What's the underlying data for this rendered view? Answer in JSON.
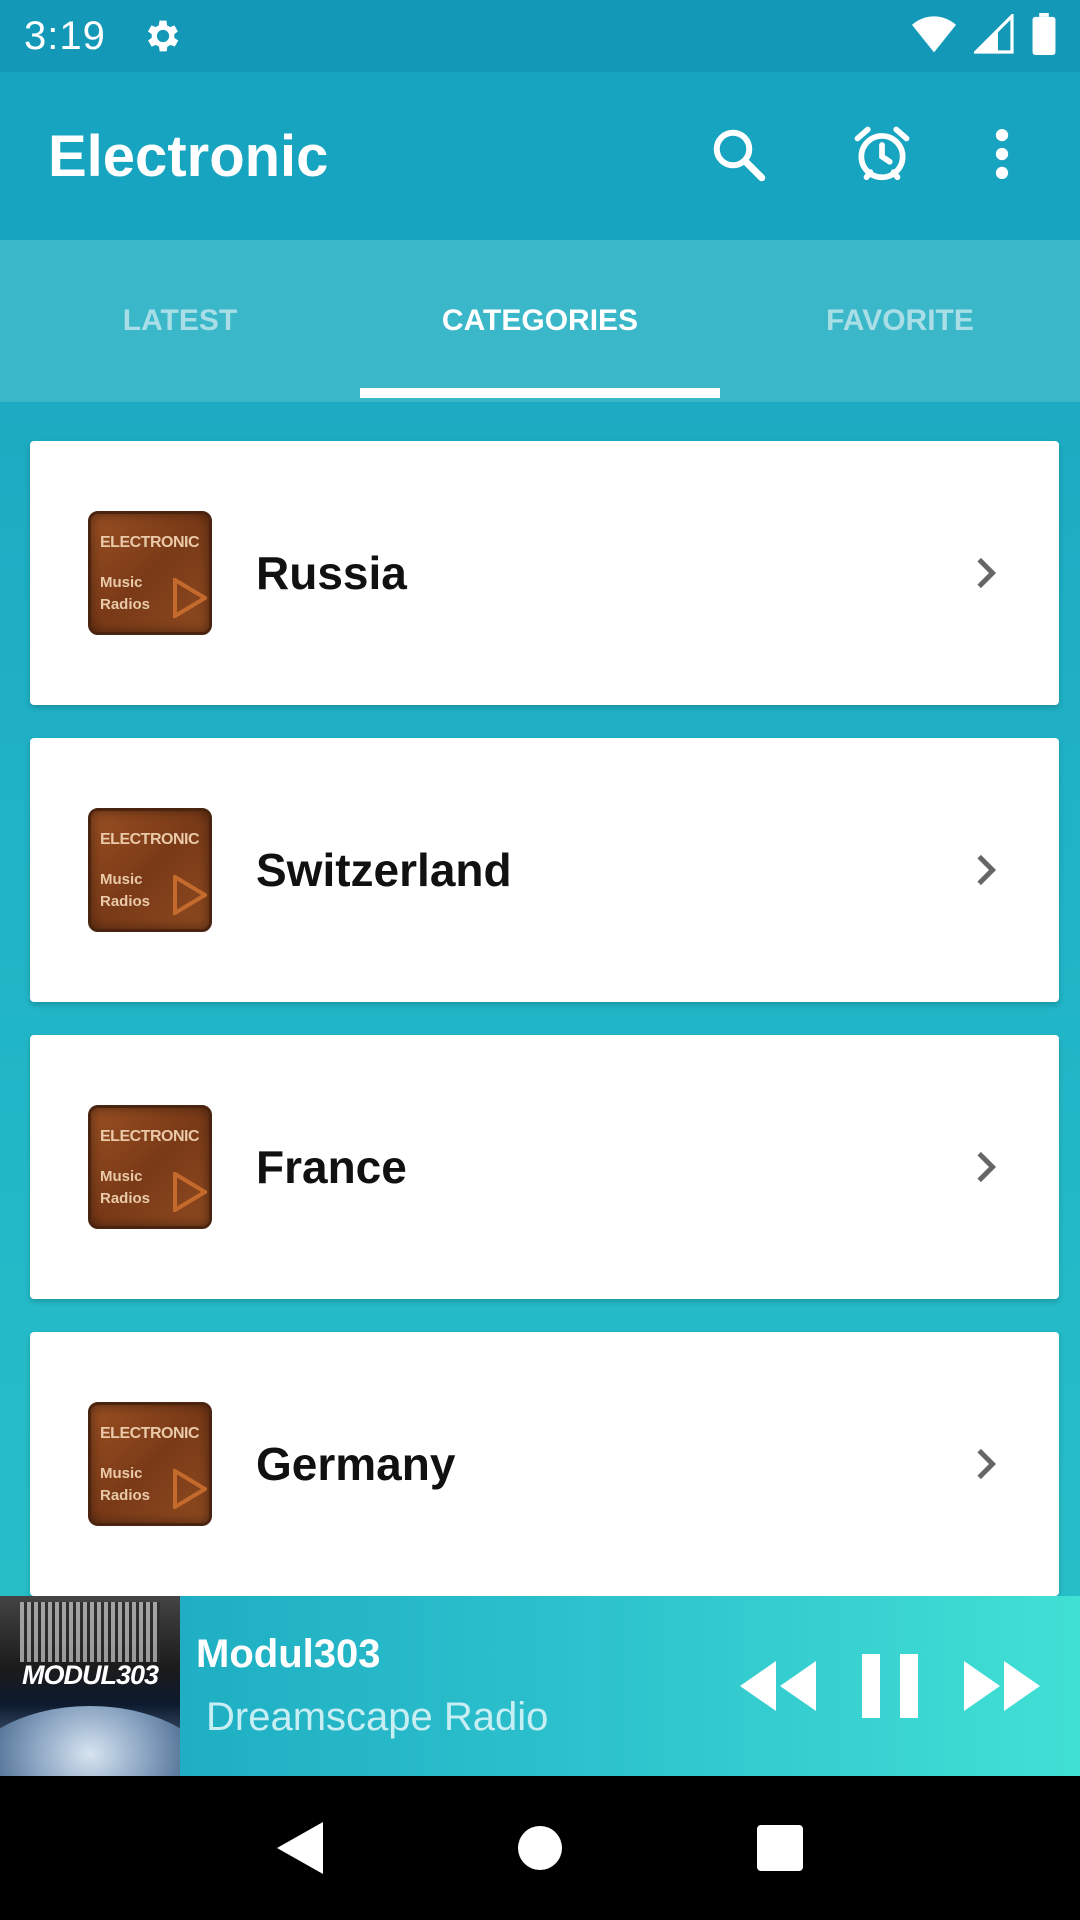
{
  "status_bar": {
    "time": "3:19"
  },
  "app_bar": {
    "title": "Electronic"
  },
  "tabs": [
    {
      "label": "LATEST",
      "active": false
    },
    {
      "label": "CATEGORIES",
      "active": true
    },
    {
      "label": "FAVORITE",
      "active": false
    }
  ],
  "thumbnail": {
    "line1": "ELECTRONIC",
    "line2": "Music",
    "line3": "Radios"
  },
  "categories": [
    {
      "label": "Russia"
    },
    {
      "label": "Switzerland"
    },
    {
      "label": "France"
    },
    {
      "label": "Germany"
    }
  ],
  "player": {
    "art_text": "MODUL303",
    "title": "Modul303",
    "subtitle": "Dreamscape Radio"
  },
  "colors": {
    "app_bar": "#17a4c0",
    "tab_bar": "#3ab8c9",
    "accent_white": "#ffffff",
    "card_bg": "#ffffff"
  },
  "icons": {
    "status": [
      "gear-icon",
      "wifi-icon",
      "signal-icon",
      "battery-icon"
    ],
    "app_bar": [
      "search-icon",
      "alarm-icon",
      "more-vert-icon"
    ],
    "player": [
      "rewind-icon",
      "pause-icon",
      "fast-forward-icon"
    ],
    "nav": [
      "back-icon",
      "home-icon",
      "recents-icon"
    ]
  }
}
